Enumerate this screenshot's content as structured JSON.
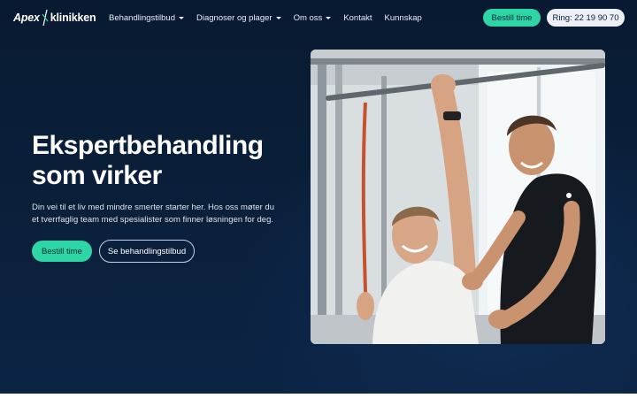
{
  "header": {
    "logo_left": "Apex",
    "logo_right": "klinikken",
    "nav": [
      {
        "label": "Behandlingstilbud",
        "dropdown": true
      },
      {
        "label": "Diagnoser og plager",
        "dropdown": true
      },
      {
        "label": "Om oss",
        "dropdown": true
      },
      {
        "label": "Kontakt",
        "dropdown": false
      },
      {
        "label": "Kunnskap",
        "dropdown": false
      }
    ],
    "book_label": "Bestill time",
    "call_label": "Ring: 22 19 90 70"
  },
  "hero": {
    "title_line1": "Ekspertbehandling",
    "title_line2": "som virker",
    "subtitle": "Din vei til et liv med mindre smerter starter her. Hos oss møter du et tverrfaglig team med spesialister som finner løsningen for deg.",
    "primary_button": "Bestill time",
    "secondary_button": "Se behandlingstilbud",
    "image_icon": "photo-therapist-treating-patient"
  },
  "colors": {
    "accent": "#2ed6a5",
    "background": "#0a1f3a",
    "text": "#ffffff"
  }
}
